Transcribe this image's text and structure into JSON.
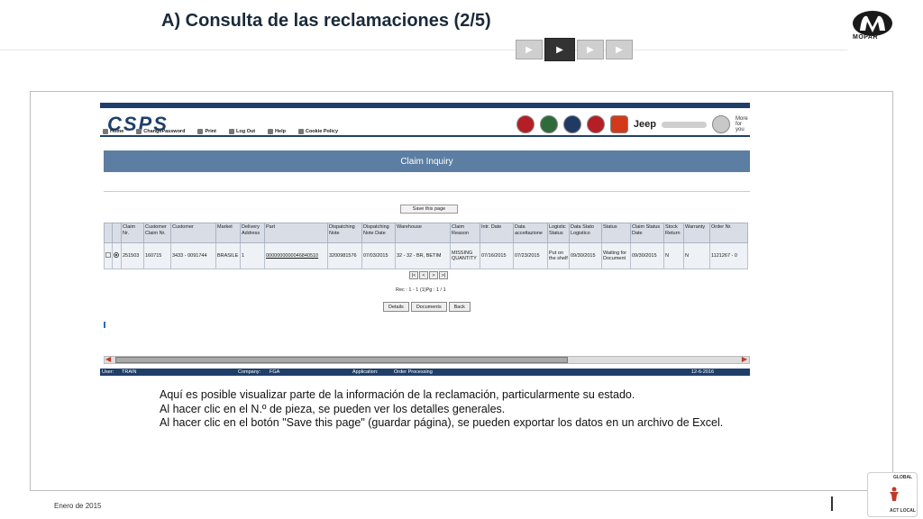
{
  "slide": {
    "title": "A) Consulta de las reclamaciones (2/5)",
    "logo_text": "MOPAR",
    "footer_date": "Enero de 2015",
    "badge_top": "GLOBAL",
    "badge_bottom": "ACT LOCAL"
  },
  "app": {
    "logo": "CSPS",
    "more_text": "More for you",
    "brand_jeep": "Jeep",
    "menu": [
      "Home",
      "ChangePassword",
      "Print",
      "Log Out",
      "Help",
      "Cookie Policy"
    ],
    "page_title": "Claim Inquiry",
    "save_button": "Save this page",
    "table": {
      "headers": [
        "Claim Nr.",
        "Customer Claim Nr.",
        "Customer",
        "Market",
        "Delivery Address",
        "Part",
        "Dispatching Note",
        "Dispatching Note Date",
        "Warehouse",
        "Claim Reason",
        "Intr. Date",
        "Data accettazione",
        "Logistic Status",
        "Data Stato Logistico",
        "Status",
        "Claim Status Date",
        "Stock Return",
        "Warranty",
        "Order Nr."
      ],
      "rows": [
        [
          "251503",
          "160715",
          "3433 - 0091744",
          "BRASILE",
          "1",
          "0000000000046840510",
          "3200981576",
          "07/03/2015",
          "32 - 32 - BR, BETIM",
          "MISSING QUANTITY",
          "07/16/2015",
          "07/23/2015",
          "Put on the shelf",
          "09/30/2015",
          "Waiting for Document",
          "09/30/2015",
          "N",
          "N",
          "1121267 - 0"
        ]
      ]
    },
    "pager": [
      "|<",
      "<",
      ">",
      ">|"
    ],
    "record_info": "Rec : 1 - 1 (1)Pg : 1 / 1",
    "actions": [
      "Details",
      "Documents",
      "Back"
    ],
    "status": {
      "user_label": "User:",
      "user": "TRAIN",
      "company_label": "Company:",
      "company": "FGA",
      "application_label": "Application:",
      "application": "Order Processing",
      "date": "12-6-2016"
    }
  },
  "caption": {
    "line1": "Aquí es posible visualizar parte de la información de la reclamación, particularmente su estado.",
    "line2": "Al hacer clic en el N.º de pieza, se pueden ver los detalles generales.",
    "line3": "Al hacer clic en el botón \"Save this page\" (guardar página), se pueden exportar los datos en un archivo de Excel."
  }
}
